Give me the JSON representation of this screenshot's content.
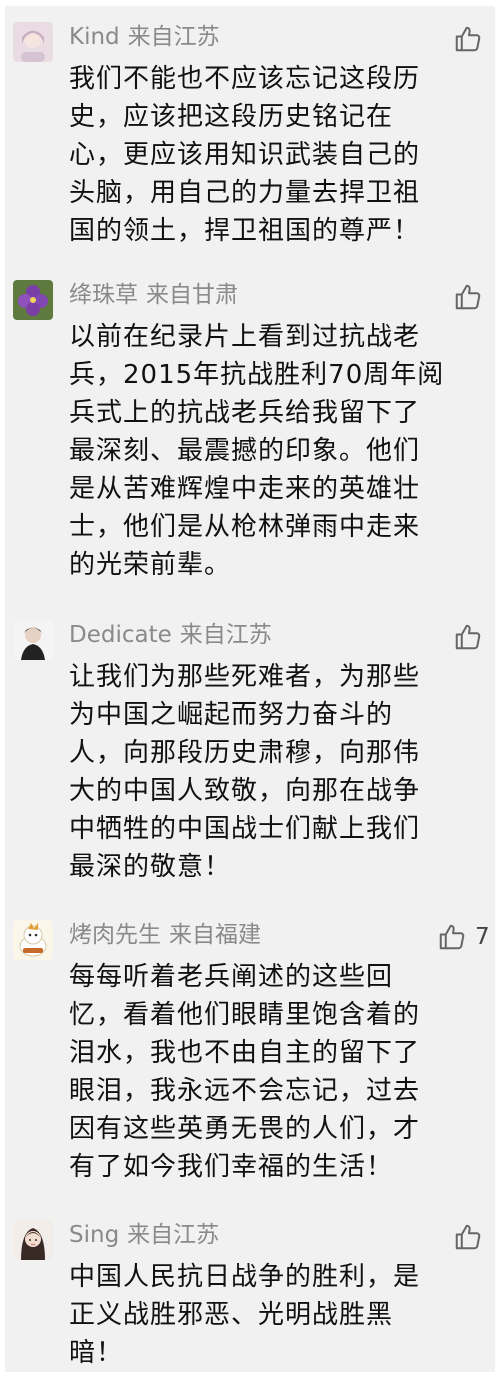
{
  "comments": [
    {
      "user": "Kind",
      "location": "来自江苏",
      "likes": "",
      "lines": [
        "我们不能也不应该忘记这段历",
        "史，应该把这段历史铭记在",
        "心，更应该用知识武装自己的",
        "头脑，用自己的力量去捍卫祖",
        "国的领土，捍卫祖国的尊严！"
      ]
    },
    {
      "user": "绛珠草",
      "location": "来自甘肃",
      "likes": "",
      "lines": [
        "以前在纪录片上看到过抗战老",
        "兵，2015年抗战胜利70周年阅",
        "兵式上的抗战老兵给我留下了",
        "最深刻、最震撼的印象。他们",
        "是从苦难辉煌中走来的英雄壮",
        "士，他们是从枪林弹雨中走来",
        "的光荣前辈。"
      ]
    },
    {
      "user": "Dedicate",
      "location": "来自江苏",
      "likes": "",
      "lines": [
        "让我们为那些死难者，为那些",
        "为中国之崛起而努力奋斗的",
        "人，向那段历史肃穆，向那伟",
        "大的中国人致敬，向那在战争",
        "中牺牲的中国战士们献上我们",
        "最深的敬意！"
      ]
    },
    {
      "user": "烤肉先生",
      "location": "来自福建",
      "likes": "7",
      "lines": [
        "每每听着老兵阐述的这些回",
        "忆，看着他们眼睛里饱含着的",
        "泪水，我也不由自主的留下了",
        "眼泪，我永远不会忘记，过去",
        "因有这些英勇无畏的人们，才",
        "有了如今我们幸福的生活！"
      ]
    },
    {
      "user": "Sing",
      "location": "来自江苏",
      "likes": "",
      "lines": [
        "中国人民抗日战争的胜利，是",
        "正义战胜邪恶、光明战胜黑",
        "暗！"
      ]
    }
  ],
  "colors": {
    "background": "#f1f1f1",
    "username": "#8a8a8a",
    "text": "#111111"
  },
  "icons": {
    "like": "thumbs-up-icon"
  }
}
